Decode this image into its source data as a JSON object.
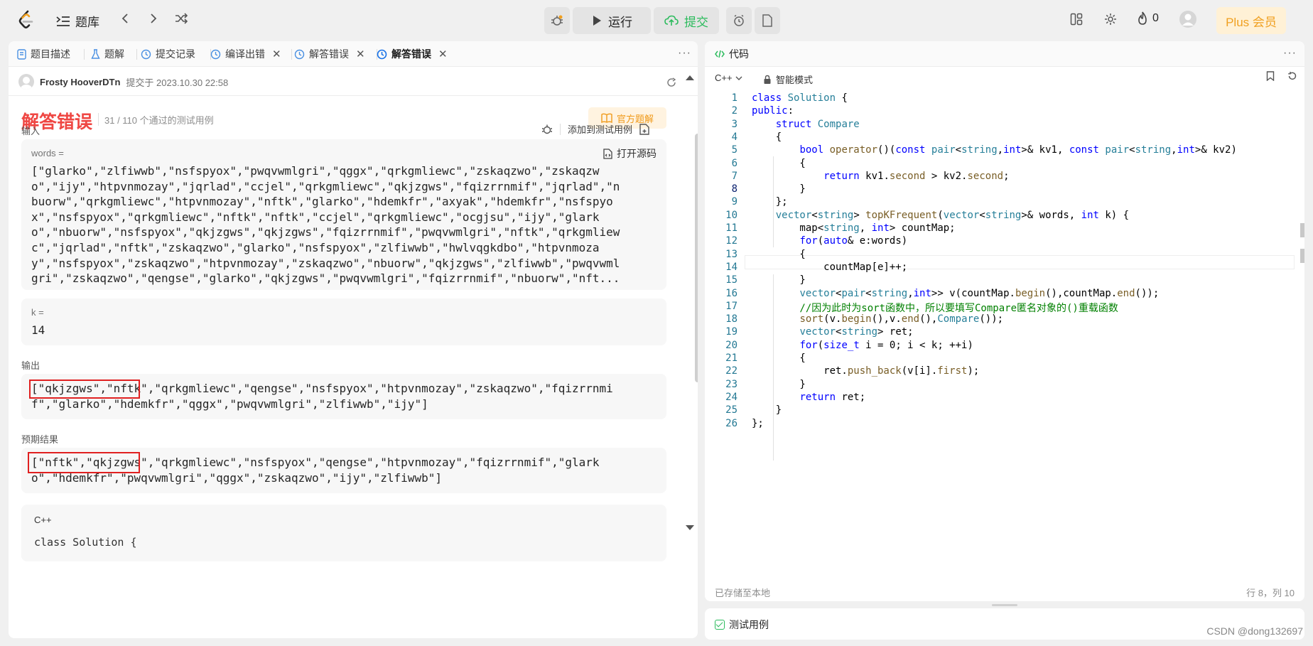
{
  "topbar": {
    "problems_label": "题库",
    "run_label": "运行",
    "submit_label": "提交",
    "fire_count": "0",
    "plus_label": "Plus 会员",
    "colors": {
      "submit": "#2cbb5d",
      "plus": "#f0a020"
    }
  },
  "left_tabs": [
    {
      "label": "题目描述",
      "icon": "description-icon"
    },
    {
      "label": "题解",
      "icon": "flask-icon"
    },
    {
      "label": "提交记录",
      "icon": "history-icon"
    },
    {
      "label": "编译出错",
      "icon": "history-icon"
    },
    {
      "label": "解答错误",
      "icon": "history-icon"
    },
    {
      "label": "解答错误",
      "icon": "history-icon"
    }
  ],
  "submission": {
    "user": "Frosty HooverDTn",
    "submitted_at": "提交于 2023.10.30 22:58",
    "result": "解答错误",
    "passed": "31 / 110 个通过的测试用例",
    "official_solution": "官方题解",
    "input_label": "输入",
    "add_testcase": "添加到测试用例",
    "open_source": "打开源码",
    "words_label": "words =",
    "words_lines": [
      "[\"glarko\",\"zlfiwwb\",\"nsfspyox\",\"pwqvwmlgri\",\"qggx\",\"qrkgmliewc\",\"zskaqzwo\",\"zskaqzw",
      "o\",\"ijy\",\"htpvnmozay\",\"jqrlad\",\"ccjel\",\"qrkgmliewc\",\"qkjzgws\",\"fqizrrnmif\",\"jqrlad\",\"n",
      "buorw\",\"qrkgmliewc\",\"htpvnmozay\",\"nftk\",\"glarko\",\"hdemkfr\",\"axyak\",\"hdemkfr\",\"nsfspyo",
      "x\",\"nsfspyox\",\"qrkgmliewc\",\"nftk\",\"nftk\",\"ccjel\",\"qrkgmliewc\",\"ocgjsu\",\"ijy\",\"glark",
      "o\",\"nbuorw\",\"nsfspyox\",\"qkjzgws\",\"qkjzgws\",\"fqizrrnmif\",\"pwqvwmlgri\",\"nftk\",\"qrkgmliew",
      "c\",\"jqrlad\",\"nftk\",\"zskaqzwo\",\"glarko\",\"nsfspyox\",\"zlfiwwb\",\"hwlvqgkdbo\",\"htpvnmoza",
      "y\",\"nsfspyox\",\"zskaqzwo\",\"htpvnmozay\",\"zskaqzwo\",\"nbuorw\",\"qkjzgws\",\"zlfiwwb\",\"pwqvwml",
      "gri\",\"zskaqzwo\",\"qengse\",\"glarko\",\"qkjzgws\",\"pwqvwmlgri\",\"fqizrrnmif\",\"nbuorw\",\"nft..."
    ],
    "k_label": "k =",
    "k_value": "14",
    "output_label": "输出",
    "output_lines": [
      "[\"qkjzgws\",\"nftk\",\"qrkgmliewc\",\"qengse\",\"nsfspyox\",\"htpvnmozay\",\"zskaqzwo\",\"fqizrrnmi",
      "f\",\"glarko\",\"hdemkfr\",\"qggx\",\"pwqvwmlgri\",\"zlfiwwb\",\"ijy\"]"
    ],
    "expected_label": "预期结果",
    "expected_lines": [
      "[\"nftk\",\"qkjzgws\",\"qrkgmliewc\",\"nsfspyox\",\"qengse\",\"htpvnmozay\",\"fqizrrnmif\",\"glark",
      "o\",\"hdemkfr\",\"pwqvwmlgri\",\"qggx\",\"zskaqzwo\",\"ijy\",\"zlfiwwb\"]"
    ],
    "code_lang": "C++",
    "code_peek": "class Solution {",
    "colors": {
      "error": "#ef4743",
      "highlight_box": "#e02020"
    }
  },
  "right": {
    "tab_label": "代码",
    "language": "C++",
    "mode": "智能模式",
    "saved_status": "已存储至本地",
    "cursor_pos": "行 8，列 10",
    "testcase_label": "测试用例",
    "watermark": "CSDN @dong132697",
    "code_lines": [
      "class Solution {",
      "public:",
      "    struct Compare",
      "    {",
      "        bool operator()(const pair<string,int>& kv1, const pair<string,int>& kv2)",
      "        {",
      "            return kv1.second > kv2.second;",
      "        }",
      "    };",
      "    vector<string> topKFrequent(vector<string>& words, int k) {",
      "        map<string, int> countMap;",
      "        for(auto& e:words)",
      "        {",
      "            countMap[e]++;",
      "        }",
      "        vector<pair<string,int>> v(countMap.begin(),countMap.end());",
      "        //因为此时为sort函数中，所以要填写Compare匿名对象的()重载函数",
      "        sort(v.begin(),v.end(),Compare());",
      "        vector<string> ret;",
      "        for(size_t i = 0; i < k; ++i)",
      "        {",
      "            ret.push_back(v[i].first);",
      "        }",
      "        return ret;",
      "    }",
      "};"
    ]
  }
}
